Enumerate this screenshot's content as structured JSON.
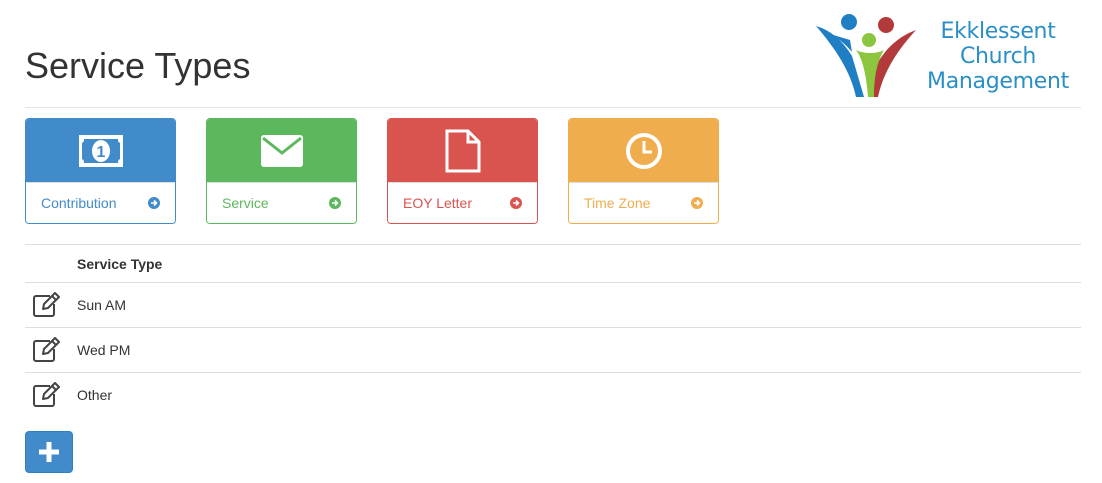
{
  "page": {
    "title": "Service Types"
  },
  "logo": {
    "line1": "Ekklessent",
    "line2": "Church",
    "line3": "Management"
  },
  "tiles": [
    {
      "label": "Contribution",
      "icon": "money-icon",
      "color": "#428bca"
    },
    {
      "label": "Service",
      "icon": "envelope-icon",
      "color": "#5cb85c"
    },
    {
      "label": "EOY Letter",
      "icon": "file-icon",
      "color": "#d9534f"
    },
    {
      "label": "Time Zone",
      "icon": "clock-icon",
      "color": "#f0ad4e"
    }
  ],
  "table": {
    "header": "Service Type",
    "rows": [
      {
        "name": "Sun AM"
      },
      {
        "name": "Wed PM"
      },
      {
        "name": "Other"
      }
    ]
  },
  "add_button": {
    "icon": "plus-icon"
  }
}
